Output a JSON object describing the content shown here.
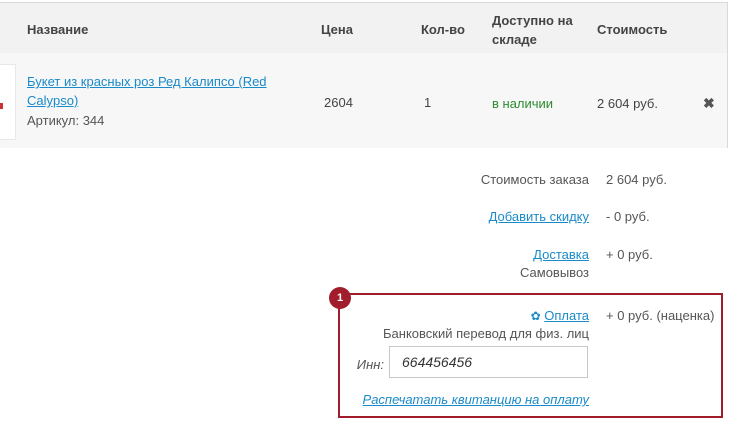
{
  "table": {
    "headers": {
      "name": "Название",
      "price": "Цена",
      "qty": "Кол-во",
      "available_line1": "Доступно на",
      "available_line2": "складе",
      "cost": "Стоимость"
    },
    "item": {
      "title_line1": "Букет из красных роз Ред Калипсо (Red",
      "title_line2": "Calypso)",
      "sku": "Артикул: 344",
      "price": "2604",
      "qty": "1",
      "availability": "в наличии",
      "cost": "2 604 руб.",
      "remove_icon": "✖"
    }
  },
  "totals": {
    "order_label": "Стоимость заказа",
    "order_value": "2 604 руб.",
    "discount_link": "Добавить скидку",
    "discount_value": "- 0 руб.",
    "delivery_link": "Доставка",
    "delivery_value": "+ 0 руб.",
    "delivery_method": "Самовывоз"
  },
  "payment": {
    "badge": "1",
    "link": "Оплата",
    "value": "+ 0 руб. (наценка)",
    "method": "Банковский перевод для физ. лиц",
    "inn_label": "Инн:",
    "inn_value": "664456456",
    "print_link": "Распечатать квитанцию на оплату"
  },
  "colors": {
    "link": "#1a8ac9",
    "in_stock": "#2e8b2e",
    "highlight": "#a11d2b"
  }
}
